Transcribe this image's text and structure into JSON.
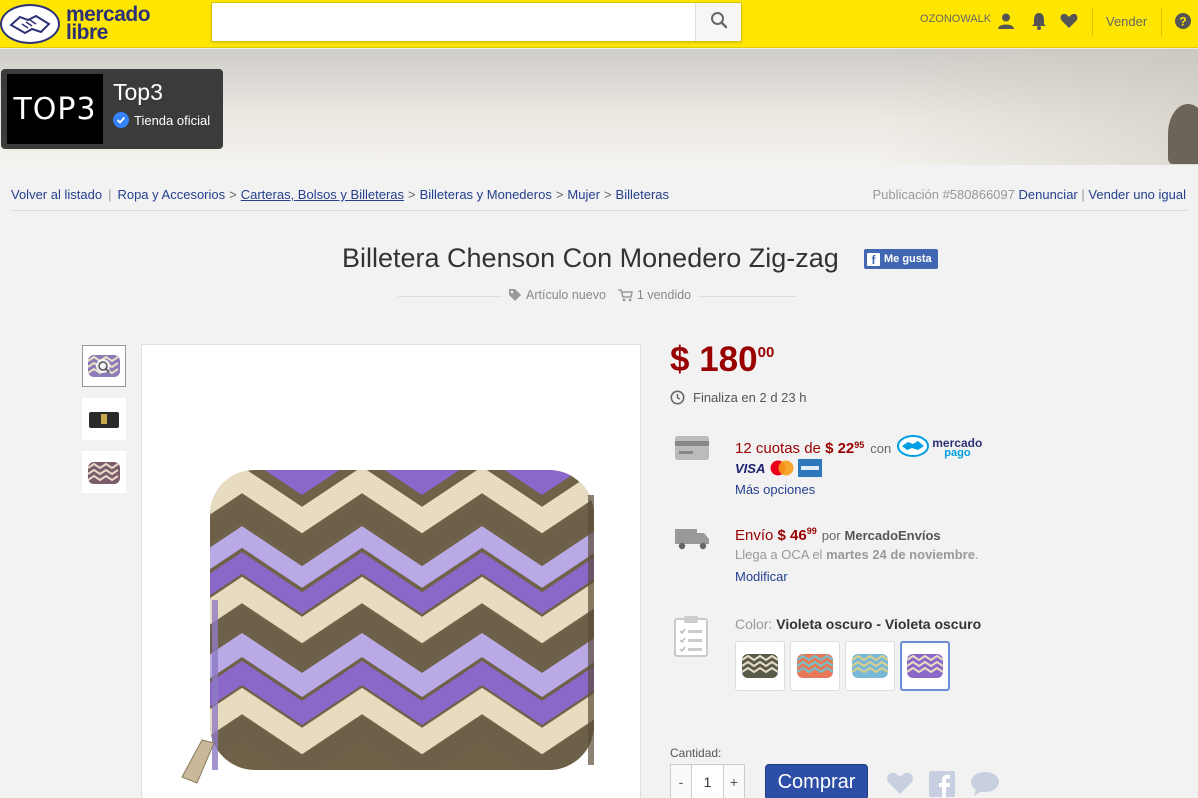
{
  "header": {
    "logo_line1": "mercado",
    "logo_line2": "libre",
    "search_placeholder": "",
    "username": "OZONOWALK",
    "sell_label": "Vender"
  },
  "store": {
    "logo_text": "TOP3",
    "name": "Top3",
    "badge": "Tienda oficial"
  },
  "breadcrumb": {
    "back": "Volver al listado",
    "items": [
      "Ropa y Accesorios",
      "Carteras, Bolsos y Billeteras",
      "Billeteras y Monederos",
      "Mujer",
      "Billeteras"
    ]
  },
  "publication": {
    "id_label": "Publicación #580866097",
    "report": "Denunciar",
    "sell_same": "Vender uno igual"
  },
  "product": {
    "title": "Billetera Chenson Con Monedero Zig-zag",
    "fb_like": "Me gusta",
    "condition": "Artículo nuevo",
    "sold": "1 vendido",
    "price_symbol": "$",
    "price_int": "180",
    "price_dec": "00",
    "ends": "Finaliza en 2 d 23 h"
  },
  "payment": {
    "installments_prefix": "12 cuotas de",
    "installment_symbol": "$",
    "installment_int": "22",
    "installment_dec": "95",
    "with": "con",
    "mp_line1": "mercado",
    "mp_line2": "pago",
    "card_visa": "VISA",
    "more": "Más opciones"
  },
  "shipping": {
    "label": "Envío",
    "symbol": "$",
    "price_int": "46",
    "price_dec": "99",
    "by": "por",
    "carrier": "MercadoEnvíos",
    "arrives_prefix": "Llega a OCA el",
    "arrives_date": "martes 24 de noviembre",
    "arrives_suffix": ".",
    "modify": "Modificar"
  },
  "variant": {
    "color_label": "Color:",
    "color_value": "Violeta oscuro - Violeta oscuro"
  },
  "purchase": {
    "qty_label": "Cantidad:",
    "minus": "-",
    "qty": "1",
    "plus": "+",
    "buy": "Comprar"
  },
  "colors": {
    "header_yellow": "#ffe600",
    "price_red": "#990000",
    "link_blue": "#24408e",
    "buy_blue": "#2d4ea6"
  }
}
